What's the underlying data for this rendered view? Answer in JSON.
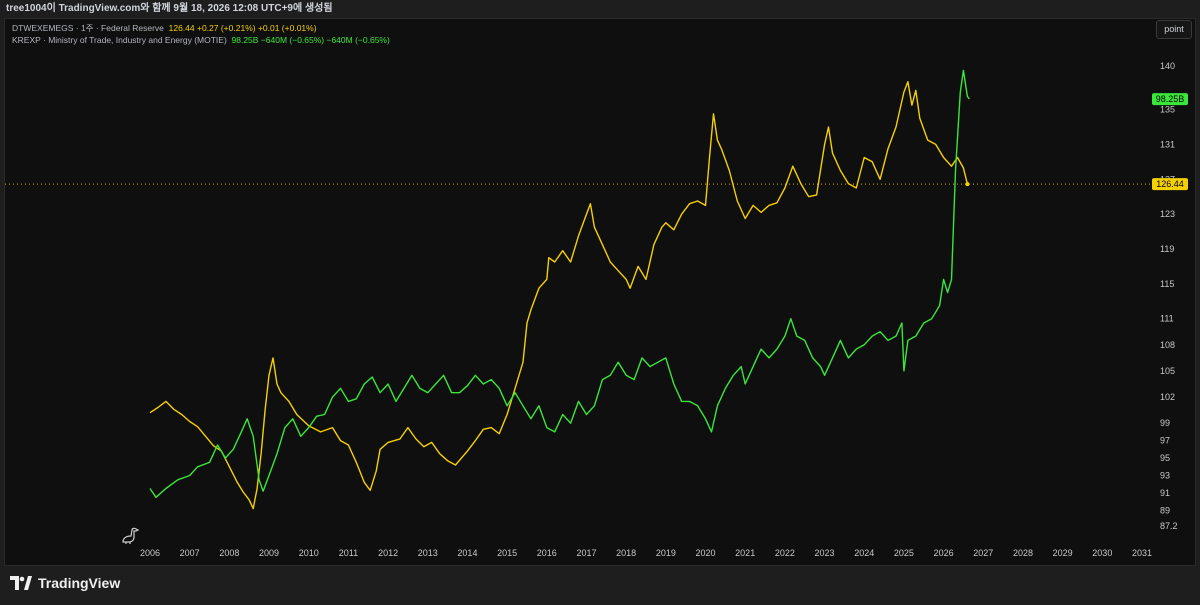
{
  "header": {
    "title": "tree1004이 TradingView.com와 함께 9월 18, 2026 12:08 UTC+9에 생성됨"
  },
  "legend": {
    "series1": {
      "label": "DTWEXEMEGS · 1주 · Federal Reserve",
      "values": "126.44 +0.27 (+0.21%) +0.01 (+0.01%)"
    },
    "series2": {
      "label": "KREXP · Ministry of Trade, Industry and Energy (MOTIE)",
      "values": "98.25B −640M (−0.65%) −640M (−0.65%)"
    }
  },
  "point_button": "point",
  "brand": {
    "name": "TradingView"
  },
  "icons": {
    "logo": "tradingview-logo-icon",
    "helper": "dinosaur-icon"
  },
  "colors": {
    "series1": "#f5d000",
    "series2": "#39e639",
    "background": "#0f0f0f",
    "axis_text": "#c8c8c8"
  },
  "chart_data": {
    "type": "line",
    "x_ticks": [
      "2006",
      "2007",
      "2008",
      "2009",
      "2010",
      "2011",
      "2012",
      "2013",
      "2014",
      "2015",
      "2016",
      "2017",
      "2018",
      "2019",
      "2020",
      "2021",
      "2022",
      "2023",
      "2024",
      "2025",
      "2026",
      "2027",
      "2028",
      "2029",
      "2030",
      "2031"
    ],
    "xlim": [
      2006,
      2031
    ],
    "y_ticks": [
      "140",
      "135",
      "131",
      "127",
      "123",
      "119",
      "115",
      "111",
      "108",
      "105",
      "102",
      "99",
      "97",
      "95",
      "93",
      "91",
      "89",
      "87.2"
    ],
    "ylim": [
      87.2,
      140
    ],
    "grid": false,
    "legend": "top-left",
    "series": [
      {
        "name": "DTWEXEMEGS",
        "current_label": "126.44",
        "current_value": 126.44,
        "points": [
          [
            2006.0,
            100.2
          ],
          [
            2006.2,
            100.8
          ],
          [
            2006.4,
            101.5
          ],
          [
            2006.6,
            100.6
          ],
          [
            2006.8,
            100.0
          ],
          [
            2007.0,
            99.2
          ],
          [
            2007.2,
            98.6
          ],
          [
            2007.4,
            97.5
          ],
          [
            2007.6,
            96.4
          ],
          [
            2007.8,
            95.8
          ],
          [
            2008.0,
            94.0
          ],
          [
            2008.2,
            92.2
          ],
          [
            2008.35,
            91.1
          ],
          [
            2008.5,
            90.2
          ],
          [
            2008.6,
            89.2
          ],
          [
            2008.7,
            91.5
          ],
          [
            2008.8,
            95.5
          ],
          [
            2008.9,
            100.5
          ],
          [
            2009.0,
            104.5
          ],
          [
            2009.1,
            106.5
          ],
          [
            2009.2,
            103.5
          ],
          [
            2009.3,
            102.5
          ],
          [
            2009.5,
            101.5
          ],
          [
            2009.7,
            100.0
          ],
          [
            2010.0,
            98.7
          ],
          [
            2010.3,
            98.0
          ],
          [
            2010.6,
            98.5
          ],
          [
            2010.8,
            97.0
          ],
          [
            2011.0,
            96.5
          ],
          [
            2011.2,
            94.5
          ],
          [
            2011.4,
            92.2
          ],
          [
            2011.55,
            91.3
          ],
          [
            2011.7,
            93.5
          ],
          [
            2011.8,
            96.0
          ],
          [
            2012.0,
            96.8
          ],
          [
            2012.3,
            97.2
          ],
          [
            2012.5,
            98.5
          ],
          [
            2012.7,
            97.2
          ],
          [
            2012.9,
            96.3
          ],
          [
            2013.1,
            96.8
          ],
          [
            2013.3,
            95.5
          ],
          [
            2013.5,
            94.7
          ],
          [
            2013.7,
            94.2
          ],
          [
            2014.0,
            95.8
          ],
          [
            2014.2,
            97.0
          ],
          [
            2014.4,
            98.3
          ],
          [
            2014.6,
            98.5
          ],
          [
            2014.8,
            97.8
          ],
          [
            2015.0,
            100.0
          ],
          [
            2015.2,
            103.0
          ],
          [
            2015.4,
            106.0
          ],
          [
            2015.5,
            110.5
          ],
          [
            2015.6,
            112.0
          ],
          [
            2015.8,
            114.5
          ],
          [
            2016.0,
            115.5
          ],
          [
            2016.05,
            118.0
          ],
          [
            2016.2,
            117.5
          ],
          [
            2016.4,
            118.8
          ],
          [
            2016.6,
            117.5
          ],
          [
            2016.8,
            120.5
          ],
          [
            2017.0,
            123.0
          ],
          [
            2017.1,
            124.2
          ],
          [
            2017.2,
            121.5
          ],
          [
            2017.4,
            119.5
          ],
          [
            2017.6,
            117.5
          ],
          [
            2017.8,
            116.5
          ],
          [
            2018.0,
            115.5
          ],
          [
            2018.1,
            114.5
          ],
          [
            2018.3,
            117.0
          ],
          [
            2018.5,
            115.5
          ],
          [
            2018.7,
            119.5
          ],
          [
            2018.9,
            121.5
          ],
          [
            2019.0,
            122.0
          ],
          [
            2019.2,
            121.2
          ],
          [
            2019.4,
            123.0
          ],
          [
            2019.6,
            124.2
          ],
          [
            2019.8,
            124.5
          ],
          [
            2020.0,
            124.0
          ],
          [
            2020.1,
            129.5
          ],
          [
            2020.2,
            134.5
          ],
          [
            2020.3,
            131.5
          ],
          [
            2020.4,
            130.5
          ],
          [
            2020.6,
            128.0
          ],
          [
            2020.8,
            124.5
          ],
          [
            2021.0,
            122.5
          ],
          [
            2021.2,
            124.0
          ],
          [
            2021.4,
            123.2
          ],
          [
            2021.6,
            124.0
          ],
          [
            2021.8,
            124.3
          ],
          [
            2022.0,
            126.0
          ],
          [
            2022.2,
            128.5
          ],
          [
            2022.4,
            126.5
          ],
          [
            2022.6,
            125.0
          ],
          [
            2022.8,
            125.2
          ],
          [
            2023.0,
            131.0
          ],
          [
            2023.1,
            133.0
          ],
          [
            2023.2,
            130.0
          ],
          [
            2023.4,
            128.0
          ],
          [
            2023.6,
            126.5
          ],
          [
            2023.8,
            126.0
          ],
          [
            2024.0,
            129.5
          ],
          [
            2024.2,
            129.0
          ],
          [
            2024.4,
            127.0
          ],
          [
            2024.6,
            130.5
          ],
          [
            2024.8,
            133.0
          ],
          [
            2025.0,
            137.0
          ],
          [
            2025.1,
            138.2
          ],
          [
            2025.2,
            135.5
          ],
          [
            2025.3,
            137.2
          ],
          [
            2025.4,
            134.0
          ],
          [
            2025.6,
            131.5
          ],
          [
            2025.8,
            131.0
          ],
          [
            2026.0,
            129.5
          ],
          [
            2026.2,
            128.5
          ],
          [
            2026.35,
            129.5
          ],
          [
            2026.5,
            128.3
          ],
          [
            2026.6,
            126.44
          ]
        ]
      },
      {
        "name": "KREXP",
        "current_label": "98.25B",
        "points": [
          [
            2006.0,
            91.5
          ],
          [
            2006.15,
            90.5
          ],
          [
            2006.4,
            91.5
          ],
          [
            2006.7,
            92.5
          ],
          [
            2007.0,
            93.0
          ],
          [
            2007.2,
            94.0
          ],
          [
            2007.5,
            94.5
          ],
          [
            2007.7,
            96.5
          ],
          [
            2007.9,
            95.0
          ],
          [
            2008.1,
            96.0
          ],
          [
            2008.3,
            98.0
          ],
          [
            2008.45,
            99.5
          ],
          [
            2008.6,
            97.5
          ],
          [
            2008.75,
            92.5
          ],
          [
            2008.85,
            91.2
          ],
          [
            2009.0,
            93.0
          ],
          [
            2009.2,
            95.5
          ],
          [
            2009.4,
            98.5
          ],
          [
            2009.6,
            99.5
          ],
          [
            2009.8,
            97.5
          ],
          [
            2010.0,
            98.5
          ],
          [
            2010.2,
            99.8
          ],
          [
            2010.4,
            100.0
          ],
          [
            2010.6,
            102.0
          ],
          [
            2010.8,
            103.0
          ],
          [
            2011.0,
            101.5
          ],
          [
            2011.2,
            101.8
          ],
          [
            2011.4,
            103.5
          ],
          [
            2011.6,
            104.3
          ],
          [
            2011.8,
            102.5
          ],
          [
            2012.0,
            103.5
          ],
          [
            2012.2,
            101.5
          ],
          [
            2012.4,
            103.0
          ],
          [
            2012.6,
            104.5
          ],
          [
            2012.8,
            103.0
          ],
          [
            2013.0,
            102.5
          ],
          [
            2013.2,
            103.5
          ],
          [
            2013.4,
            104.5
          ],
          [
            2013.6,
            102.5
          ],
          [
            2013.8,
            102.5
          ],
          [
            2014.0,
            103.3
          ],
          [
            2014.2,
            104.5
          ],
          [
            2014.4,
            103.5
          ],
          [
            2014.6,
            104.0
          ],
          [
            2014.8,
            103.0
          ],
          [
            2015.0,
            101.0
          ],
          [
            2015.2,
            102.5
          ],
          [
            2015.4,
            101.0
          ],
          [
            2015.6,
            99.5
          ],
          [
            2015.8,
            101.0
          ],
          [
            2016.0,
            98.5
          ],
          [
            2016.2,
            98.0
          ],
          [
            2016.4,
            100.0
          ],
          [
            2016.6,
            99.0
          ],
          [
            2016.8,
            101.5
          ],
          [
            2017.0,
            100.0
          ],
          [
            2017.2,
            101.0
          ],
          [
            2017.4,
            104.0
          ],
          [
            2017.6,
            104.5
          ],
          [
            2017.8,
            106.0
          ],
          [
            2018.0,
            104.5
          ],
          [
            2018.2,
            104.0
          ],
          [
            2018.4,
            106.5
          ],
          [
            2018.6,
            105.5
          ],
          [
            2018.8,
            106.0
          ],
          [
            2019.0,
            106.5
          ],
          [
            2019.2,
            103.5
          ],
          [
            2019.4,
            101.5
          ],
          [
            2019.6,
            101.5
          ],
          [
            2019.8,
            101.0
          ],
          [
            2020.0,
            99.5
          ],
          [
            2020.15,
            98.0
          ],
          [
            2020.3,
            101.0
          ],
          [
            2020.5,
            103.0
          ],
          [
            2020.7,
            104.5
          ],
          [
            2020.9,
            105.5
          ],
          [
            2021.0,
            103.5
          ],
          [
            2021.2,
            105.5
          ],
          [
            2021.4,
            107.5
          ],
          [
            2021.6,
            106.5
          ],
          [
            2021.8,
            107.5
          ],
          [
            2022.0,
            109.0
          ],
          [
            2022.15,
            111.0
          ],
          [
            2022.3,
            109.0
          ],
          [
            2022.5,
            108.5
          ],
          [
            2022.7,
            106.5
          ],
          [
            2022.9,
            105.5
          ],
          [
            2023.0,
            104.5
          ],
          [
            2023.2,
            106.5
          ],
          [
            2023.4,
            108.5
          ],
          [
            2023.6,
            106.5
          ],
          [
            2023.8,
            107.5
          ],
          [
            2024.0,
            108.0
          ],
          [
            2024.2,
            109.0
          ],
          [
            2024.4,
            109.5
          ],
          [
            2024.6,
            108.5
          ],
          [
            2024.8,
            109.0
          ],
          [
            2024.95,
            110.5
          ],
          [
            2025.0,
            105.0
          ],
          [
            2025.1,
            108.5
          ],
          [
            2025.3,
            109.0
          ],
          [
            2025.5,
            110.5
          ],
          [
            2025.7,
            111.0
          ],
          [
            2025.9,
            112.5
          ],
          [
            2026.0,
            115.5
          ],
          [
            2026.1,
            114.0
          ],
          [
            2026.2,
            115.5
          ],
          [
            2026.3,
            128.0
          ],
          [
            2026.42,
            137.0
          ],
          [
            2026.5,
            139.5
          ],
          [
            2026.6,
            136.5
          ],
          [
            2026.65,
            136.2
          ]
        ]
      }
    ]
  }
}
